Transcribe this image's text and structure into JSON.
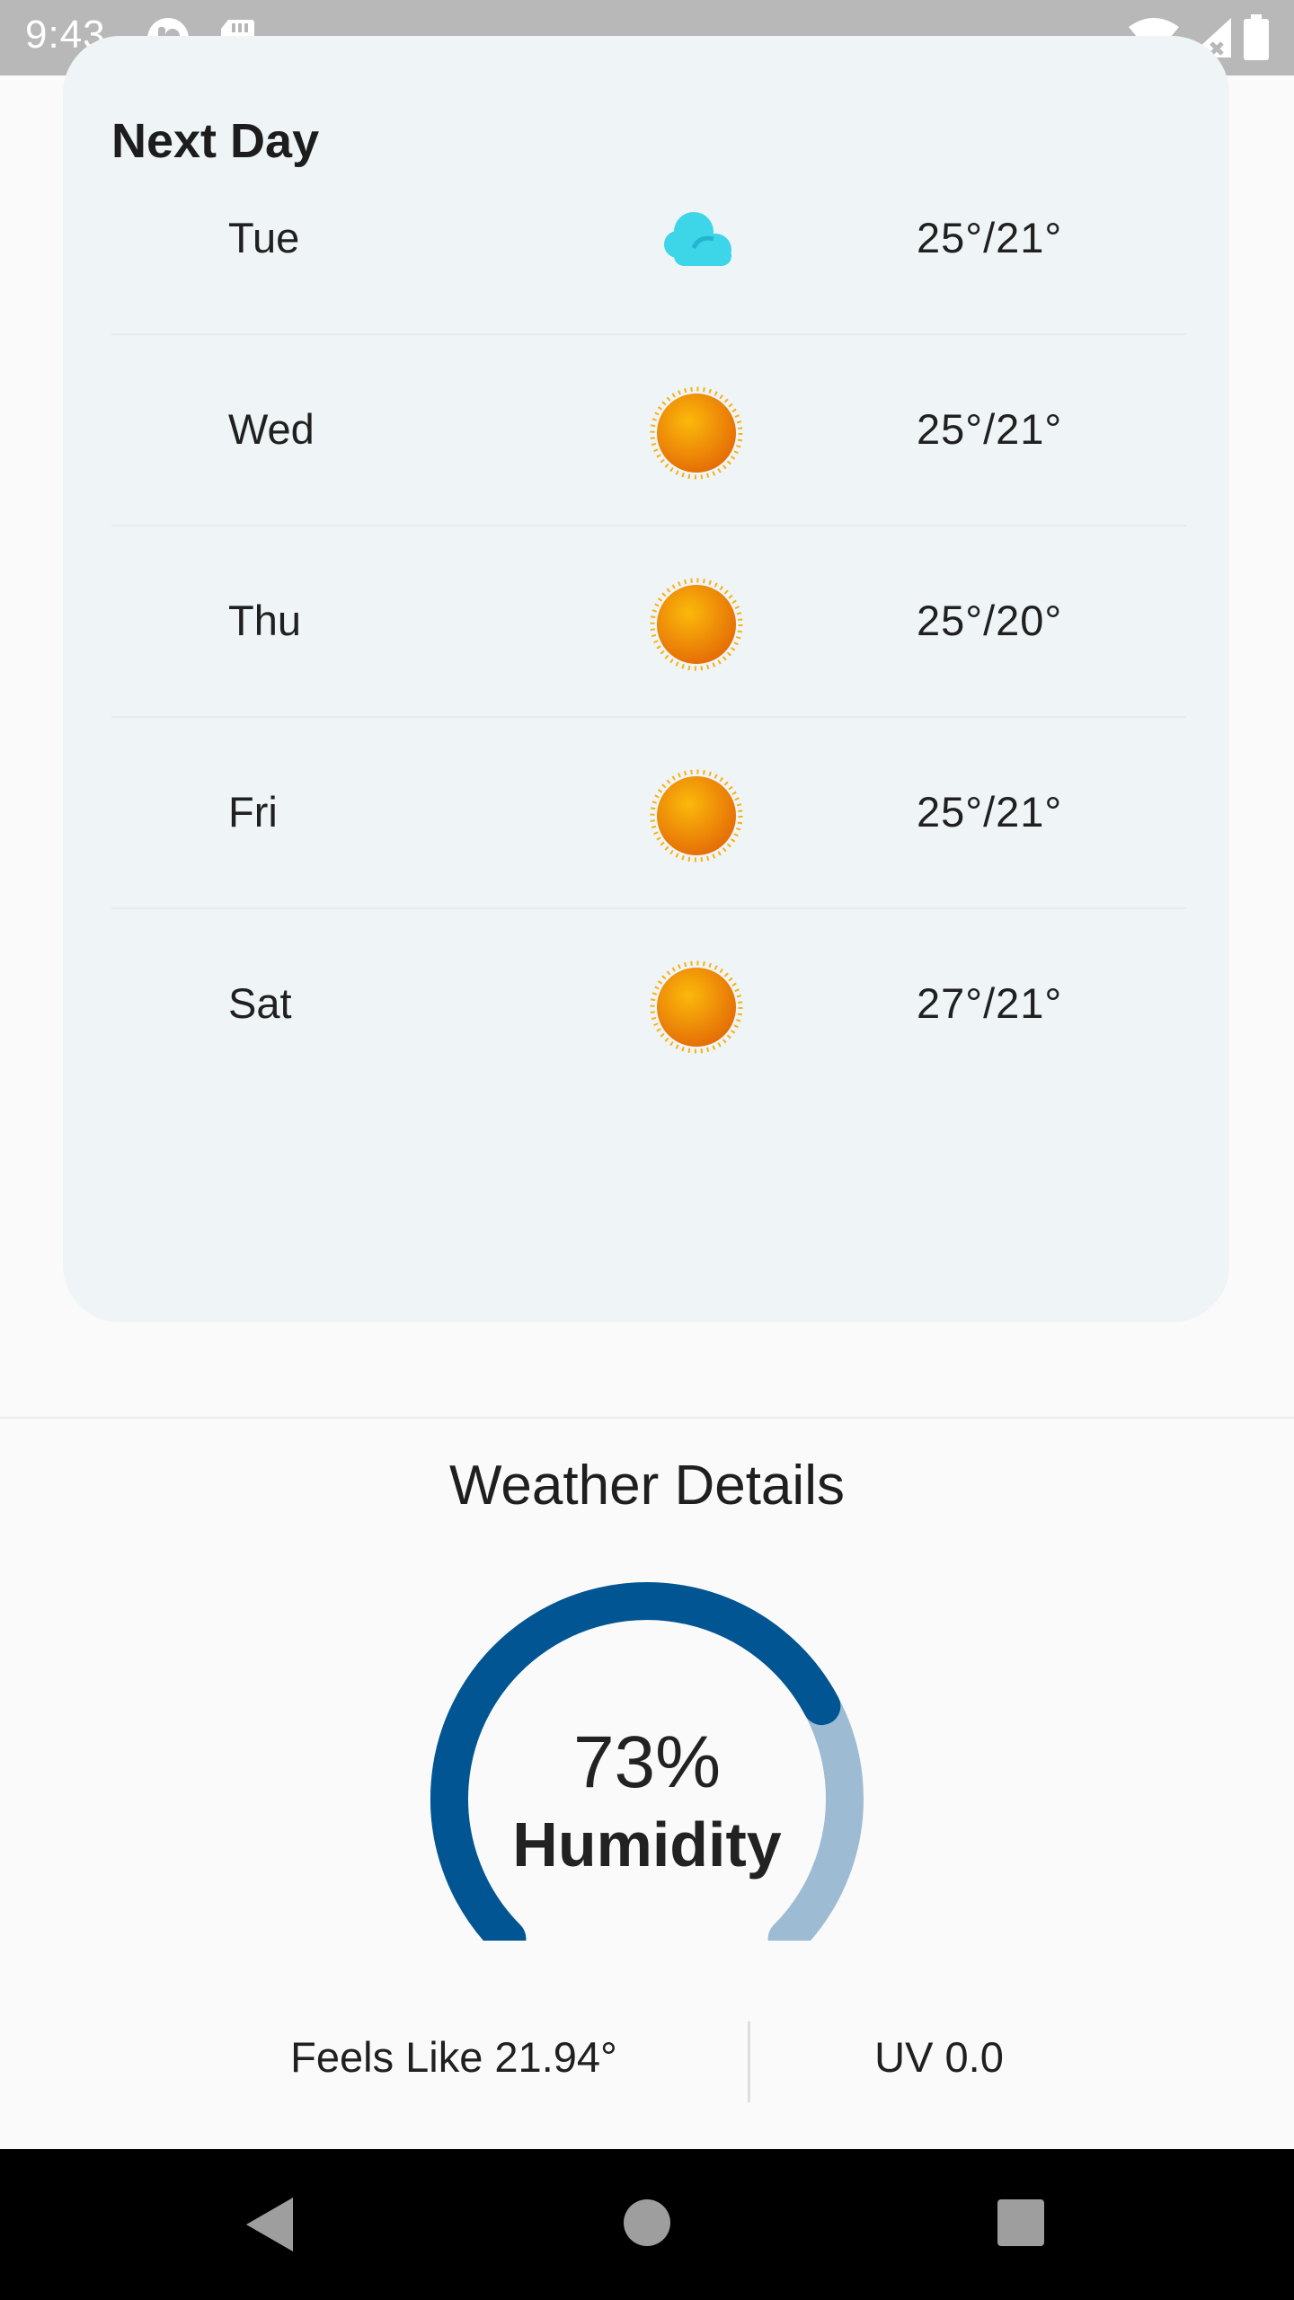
{
  "status_bar": {
    "time": "9:43",
    "icons": [
      "app-notification-icon",
      "sd-card-icon",
      "wifi-icon",
      "cell-signal-icon",
      "battery-icon"
    ]
  },
  "next_day": {
    "title": "Next Day",
    "days": [
      {
        "day": "Tue",
        "icon": "partly-cloudy-icon",
        "temp": "25°/21°"
      },
      {
        "day": "Wed",
        "icon": "sun-icon",
        "temp": "25°/21°"
      },
      {
        "day": "Thu",
        "icon": "sun-icon",
        "temp": "25°/20°"
      },
      {
        "day": "Fri",
        "icon": "sun-icon",
        "temp": "25°/21°"
      },
      {
        "day": "Sat",
        "icon": "sun-icon",
        "temp": "27°/21°"
      }
    ]
  },
  "weather_details": {
    "title": "Weather Details",
    "humidity_value": "73%",
    "humidity_label": "Humidity",
    "humidity_fraction": 0.73,
    "feels_like": "Feels Like 21.94°",
    "uv": "UV 0.0"
  },
  "colors": {
    "card_bg": "#eff4f6",
    "gauge_fill": "#005592",
    "gauge_track": "#9dbcd3",
    "cloud": "#3dd6e8",
    "sun": "#f5a00b"
  },
  "nav_bar": {
    "icons": [
      "back-icon",
      "home-icon",
      "recents-icon"
    ]
  }
}
